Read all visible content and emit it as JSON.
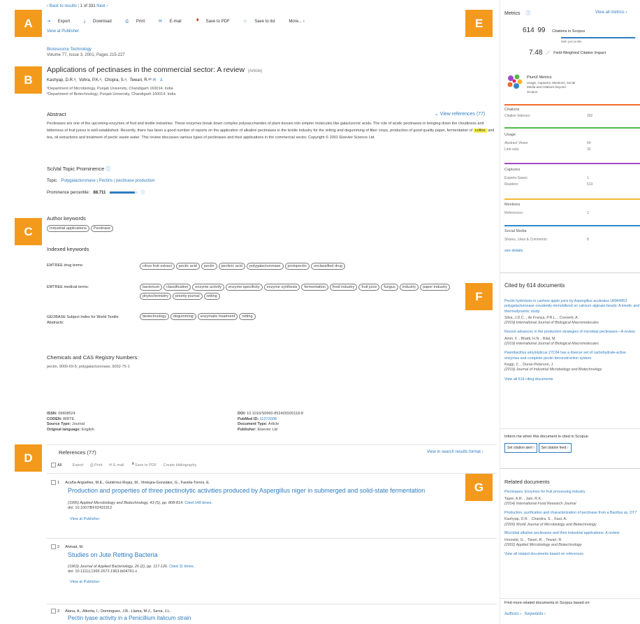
{
  "nav": {
    "back": "‹ Back to results",
    "pager": "1  of  331",
    "next": "Next ›"
  },
  "toolbar": {
    "export": "Export",
    "download": "Download",
    "print": "Print",
    "email": "E-mail",
    "save_pdf": "Save to PDF",
    "save_list": "Save to list",
    "more": "More... ›",
    "view_publisher": "View at Publisher"
  },
  "labels": {
    "a": "A",
    "b": "B",
    "c": "C",
    "d": "D",
    "e": "E",
    "f": "F",
    "g": "G"
  },
  "article": {
    "journal": "Bioresource Technology",
    "volume": "Volume 77, Issue 3, 2001, Pages 215-227",
    "title": "Applications of pectinases in the commercial sector: A review",
    "type": "(Article)",
    "authors": [
      "Kashyap, D.R.ᵃ,",
      "Vohra, P.K.ᵃ,",
      "Chopra, S.ᵃ,",
      "Tewari, R.ᵃᵇ"
    ],
    "aff1": "ᵃDepartment of Microbiology, Punjab University, Chandigarh 160014, India",
    "aff2": "ᵇDepartment of Biotechnology, Punjab University, Chandigarh 160014, India"
  },
  "abstract": {
    "heading": "Abstract",
    "view_refs": "⌄ View references (77)",
    "text_before": "Pectinases are one of the upcoming enzymes of fruit and textile industries. These enzymes break down complex polysaccharides of plant tissues into simpler molecules like galacturonic acids. The role of acidic pectinases in bringing down the cloudiness and bitterness of fruit juices is well-established. Recently, there has been a good number of reports on the application of alkaline pectinases in the textile industry for the retting and degumming of fiber crops, production of good quality paper, fermentation of",
    "highlight": "coffee",
    "text_after": "and tea, oil extractions and treatment of pectic waste water. This review discusses various types of pectinases and their applications in the commercial sector. Copyright © 2001 Elsevier Science Ltd."
  },
  "scival": {
    "heading": "SciVal Topic Prominence",
    "topic_label": "Topic:",
    "topic": "Polygalacturonase | Pectins | pectinase production",
    "percentile_label": "Prominence percentile:",
    "percentile": "88.711",
    "percentile_value": 0.887
  },
  "keywords": {
    "author_heading": "Author keywords",
    "author": [
      "Industrial applications",
      "Pectinase"
    ],
    "indexed_heading": "Indexed keywords",
    "groups": [
      {
        "label": "EMTREE drug terms:",
        "terms": [
          "citrus fruit extract",
          "pectic acid",
          "pectin",
          "pectinic acid",
          "polygalacturonase",
          "protopectin",
          "unclassified drug"
        ]
      },
      {
        "label": "EMTREE medical terms:",
        "terms": [
          "bacterium",
          "classification",
          "enzyme activity",
          "enzyme specificity",
          "enzyme synthesis",
          "fermentation",
          "food industry",
          "fruit juice",
          "fungus",
          "industry",
          "paper industry",
          "phytochemistry",
          "priority journal",
          "retting"
        ]
      },
      {
        "label": "GEOBASE Subject Index for World Textile Abstracts:",
        "terms": [
          "biotechnology",
          "degumming",
          "enzymatic treatment",
          "retting"
        ]
      }
    ]
  },
  "chemicals": {
    "heading": "Chemicals and CAS Registry Numbers:",
    "text": "pectin, 9000-69-5; polygalacturonase, 9032-75-1"
  },
  "meta": {
    "issn_label": "ISSN:",
    "issn": "09608524",
    "coden_label": "CODEN:",
    "coden": "BIRTE",
    "source_label": "Source Type:",
    "source": "Journal",
    "lang_label": "Original language:",
    "lang": "English",
    "doi_label": "DOI:",
    "doi": "10.1016/S0960-8524(00)00118-8",
    "pubmed_label": "PubMed ID:",
    "pubmed": "11272008",
    "doctype_label": "Document Type:",
    "doctype": "Article",
    "publisher_label": "Publisher:",
    "publisher": "Elsevier Ltd"
  },
  "references": {
    "heading": "References (77)",
    "view_search": "View in search results format ›",
    "tools": {
      "all": "All",
      "export": "Export",
      "print": "Print",
      "email": "E-mail",
      "pdf": "Save to PDF",
      "bib": "Create bibliography"
    },
    "items": [
      {
        "num": "1",
        "authors": "Acuña-Argüelles, M.E., Gutiérrez-Rojas, M., Viniegra-González, G., Favela-Torres, E.",
        "title": "Production and properties of three pectinolytic activities produced by Aspergillus niger in submerged and solid-state fermentation",
        "source": "(1995) Applied Microbiology and Biotechnology, 43 (5), pp. 808-814.",
        "cited": "Cited 148 times.",
        "doi": "doi: 10.1007/BF02431912",
        "pub": "View at Publisher"
      },
      {
        "num": "2",
        "authors": "Ahmad, M.",
        "title": "Studies on Jute Retting Bacteria",
        "source": "(1963) Journal of Applied Bacteriology, 26 (2), pp. 117-126.",
        "cited": "Cited 11 times.",
        "doi": "doi: 10.1111/j.1365-2672.1963.tb04761.x",
        "pub": "View at Publisher"
      },
      {
        "num": "3",
        "authors": "Alana, A., Alkorta, I., Dominguez, J.B., Llama, M.J., Serra, J.L.",
        "title": "Pectin lyase activity in a Penicillium italicum strain"
      }
    ]
  },
  "metrics": {
    "heading": "Metrics",
    "view_all": "View all metrics ›",
    "citations": "614",
    "citations_pct": "99",
    "citations_label": "Citations in Scopus",
    "percentile_label": "96th percentile",
    "fwci": "7.48",
    "fwci_label": "Field-Weighted Citation Impact",
    "plumx_title": "PlumX Metrics",
    "plumx_desc": "Usage, Captures, Mentions, Social Media and Citations beyond Scopus.",
    "groups": [
      {
        "name": "Citations",
        "color": "#f26b2a",
        "rows": [
          {
            "k": "Citation Indexes:",
            "v": "392"
          }
        ]
      },
      {
        "name": "Usage",
        "color": "#54b84a",
        "rows": [
          {
            "k": "Abstract Views:",
            "v": "64"
          },
          {
            "k": "Link-outs:",
            "v": "32"
          }
        ]
      },
      {
        "name": "Captures",
        "color": "#a048c8",
        "rows": [
          {
            "k": "Exports-Saves:",
            "v": "1"
          },
          {
            "k": "Readers:",
            "v": "513"
          }
        ]
      },
      {
        "name": "Mentions",
        "color": "#f5b731",
        "rows": [
          {
            "k": "References:",
            "v": "1"
          }
        ]
      },
      {
        "name": "Social Media",
        "color": "#2f86c8",
        "rows": [
          {
            "k": "Shares, Likes & Comments:",
            "v": "8"
          }
        ]
      }
    ],
    "see_details": "see details"
  },
  "cited_by": {
    "heading": "Cited by 614 documents",
    "items": [
      {
        "title": "Pectin hydrolysis in cashew apple juice by Aspergillus aculeatus URM4953 polygalacturonase covalently-immobilized on calcium alginate beads: A kinetic and thermodynamic study",
        "authors": "Silva, J.D.C. , de França, P.R.L. , Converti, A.",
        "source": "(2019) International Journal of Biological Macromolecules"
      },
      {
        "title": "Recent advances in the production strategies of microbial pectinases—A review",
        "authors": "Amin, F. , Bhatti, H.N. , Bilal, M.",
        "source": "(2019) International Journal of Biological Macromolecules"
      },
      {
        "title": "Paenibacillus amylolyticus 27C64 has a diverse set of carbohydrate-active enzymes and complete pectin deconstruction system",
        "authors": "Keggi, C. , Doran-Peterson, J.",
        "source": "(2019) Journal of Industrial Microbiology and Biotechnology"
      }
    ],
    "view_all": "View all 614 citing documents",
    "inform": "Inform me when this document is cited in Scopus:",
    "alert_btn": "Set citation alert ›",
    "feed_btn": "Set citation feed ›"
  },
  "related": {
    "heading": "Related documents",
    "items": [
      {
        "title": "Pectinases: Enzymes for fruit processing industry",
        "authors": "Tapre, A.R. , Jain, R.K.",
        "source": "(2014) International Food Research Journal"
      },
      {
        "title": "Production, purification and characterization of pectinase from a Bacillus sp. DT7",
        "authors": "Kashyap, D.R. , Chandra, S. , Kaul, A.",
        "source": "(2000) World Journal of Microbiology and Biotechnology"
      },
      {
        "title": "Microbial alkaline pectinases and their industrial applications: A review",
        "authors": "Hoondal, G. , Tiwari, R. , Tewari, R.",
        "source": "(2002) Applied Microbiology and Biotechnology"
      }
    ],
    "view_all": "View all related documents based on references",
    "find_more": "Find more related documents in Scopus based on:",
    "authors_link": "Authors ›",
    "keywords_link": "Keywords ›"
  }
}
